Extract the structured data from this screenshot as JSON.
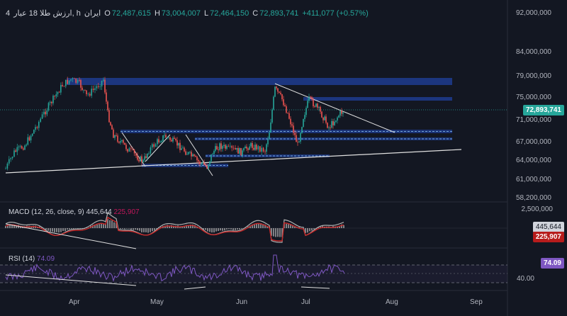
{
  "legend": {
    "interval": "4",
    "symbol": "ارزش طلا 18 عیار, h",
    "open_label": "O",
    "open": "72,487,615",
    "high_label": "H",
    "high": "73,004,007",
    "low_label": "L",
    "low": "72,464,150",
    "close_label": "C",
    "close": "72,893,741",
    "change": "+411,077 (+0.57%)",
    "exchange": "ایران"
  },
  "price_axis": [
    "92,000,000",
    "84,000,000",
    "79,000,000",
    "75,000,000",
    "71,000,000",
    "67,000,000",
    "64,000,000",
    "61,000,000",
    "58,200,000"
  ],
  "current_price": "72,893,741",
  "macd": {
    "label": "MACD (12, 26, close, 9)",
    "value1": "445,644",
    "value2": "225,907",
    "axis": [
      "2,500,000"
    ],
    "tag1": "445,644",
    "tag2": "225,907"
  },
  "rsi": {
    "label": "RSI (14)",
    "value": "74.09",
    "axis": [
      "40.00"
    ],
    "tag": "74.09"
  },
  "time_axis": [
    "Apr",
    "May",
    "Jun",
    "Jul",
    "Aug",
    "Sep"
  ],
  "colors": {
    "background": "#131722",
    "up": "#26a69a",
    "down": "#ef5350",
    "zone": "#1e3a8a",
    "macd_line": "#b0b0b0",
    "signal_line": "#c62828",
    "rsi_line": "#7e57c2",
    "current_price_tag": "#26a69a"
  },
  "chart_data": {
    "type": "candlestick",
    "panes": [
      "price",
      "macd",
      "rsi"
    ],
    "price_range": [
      58200000,
      92000000
    ],
    "x_months": [
      "Apr",
      "May",
      "Jun",
      "Jul",
      "Aug",
      "Sep"
    ]
  }
}
